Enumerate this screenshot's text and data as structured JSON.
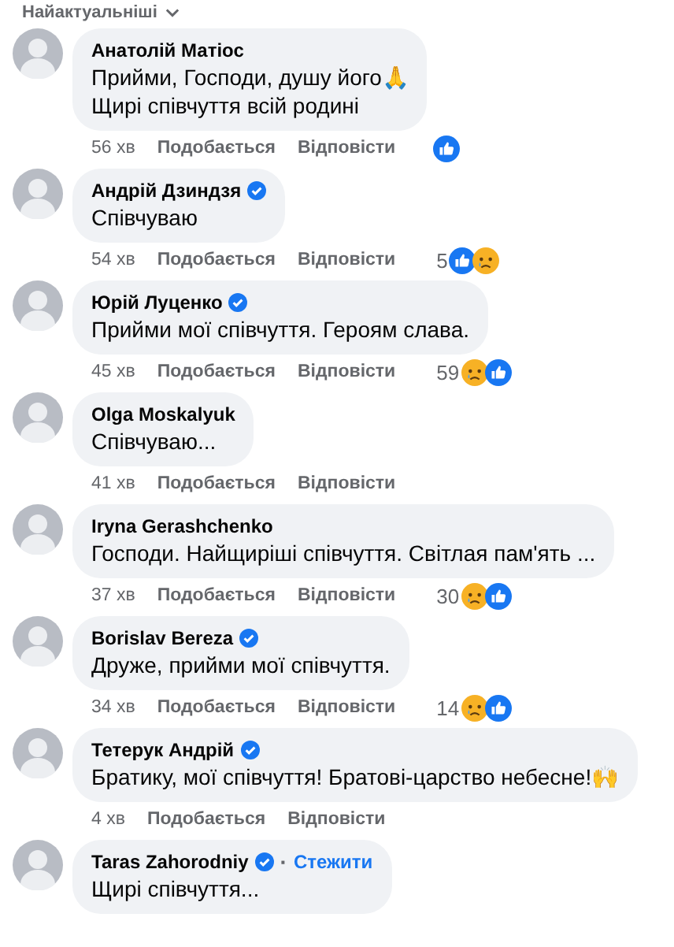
{
  "sort_label": "Найактуальніші",
  "comments": [
    {
      "author": "Анатолій Матіос",
      "verified": false,
      "lines": [
        "Прийми, Господи, душу його🙏",
        "Щирі співчуття всій родині"
      ],
      "time": "56 хв",
      "like": "Подобається",
      "reply": "Відповісти",
      "reactions": [
        {
          "kind": "like"
        }
      ]
    },
    {
      "author": "Андрій Дзиндзя",
      "verified": true,
      "lines": [
        "Співчуваю"
      ],
      "time": "54 хв",
      "like": "Подобається",
      "reply": "Відповісти",
      "reaction_count": "5",
      "reactions": [
        {
          "kind": "like"
        },
        {
          "kind": "sad"
        }
      ]
    },
    {
      "author": "Юрій Луценко",
      "verified": true,
      "lines": [
        "Прийми мої співчуття. Героям слава."
      ],
      "time": "45 хв",
      "like": "Подобається",
      "reply": "Відповісти",
      "reaction_count": "59",
      "reactions": [
        {
          "kind": "sad"
        },
        {
          "kind": "like"
        }
      ]
    },
    {
      "author": "Olga Moskalyuk",
      "verified": false,
      "lines": [
        "Співчуваю..."
      ],
      "time": "41 хв",
      "like": "Подобається",
      "reply": "Відповісти"
    },
    {
      "author": "Iryna Gerashchenko",
      "verified": false,
      "lines": [
        "Господи. Найщиріші співчуття. Світлая пам'ять ..."
      ],
      "time": "37 хв",
      "like": "Подобається",
      "reply": "Відповісти",
      "reaction_count": "30",
      "reactions": [
        {
          "kind": "sad"
        },
        {
          "kind": "like"
        }
      ]
    },
    {
      "author": "Borislav Bereza",
      "verified": true,
      "lines": [
        "Друже, прийми мої співчуття."
      ],
      "time": "34 хв",
      "like": "Подобається",
      "reply": "Відповісти",
      "reaction_count": "14",
      "reactions": [
        {
          "kind": "sad"
        },
        {
          "kind": "like"
        }
      ]
    },
    {
      "author": "Тетерук Андрій",
      "verified": true,
      "lines": [
        "Братику, мої співчуття! Братові-царство небесне!🙌"
      ],
      "time": "4 хв",
      "like": "Подобається",
      "reply": "Відповісти"
    },
    {
      "author": "Taras Zahorodniy",
      "verified": true,
      "separator": "·",
      "follow": "Стежити",
      "lines": [
        "Щирі співчуття..."
      ]
    }
  ]
}
